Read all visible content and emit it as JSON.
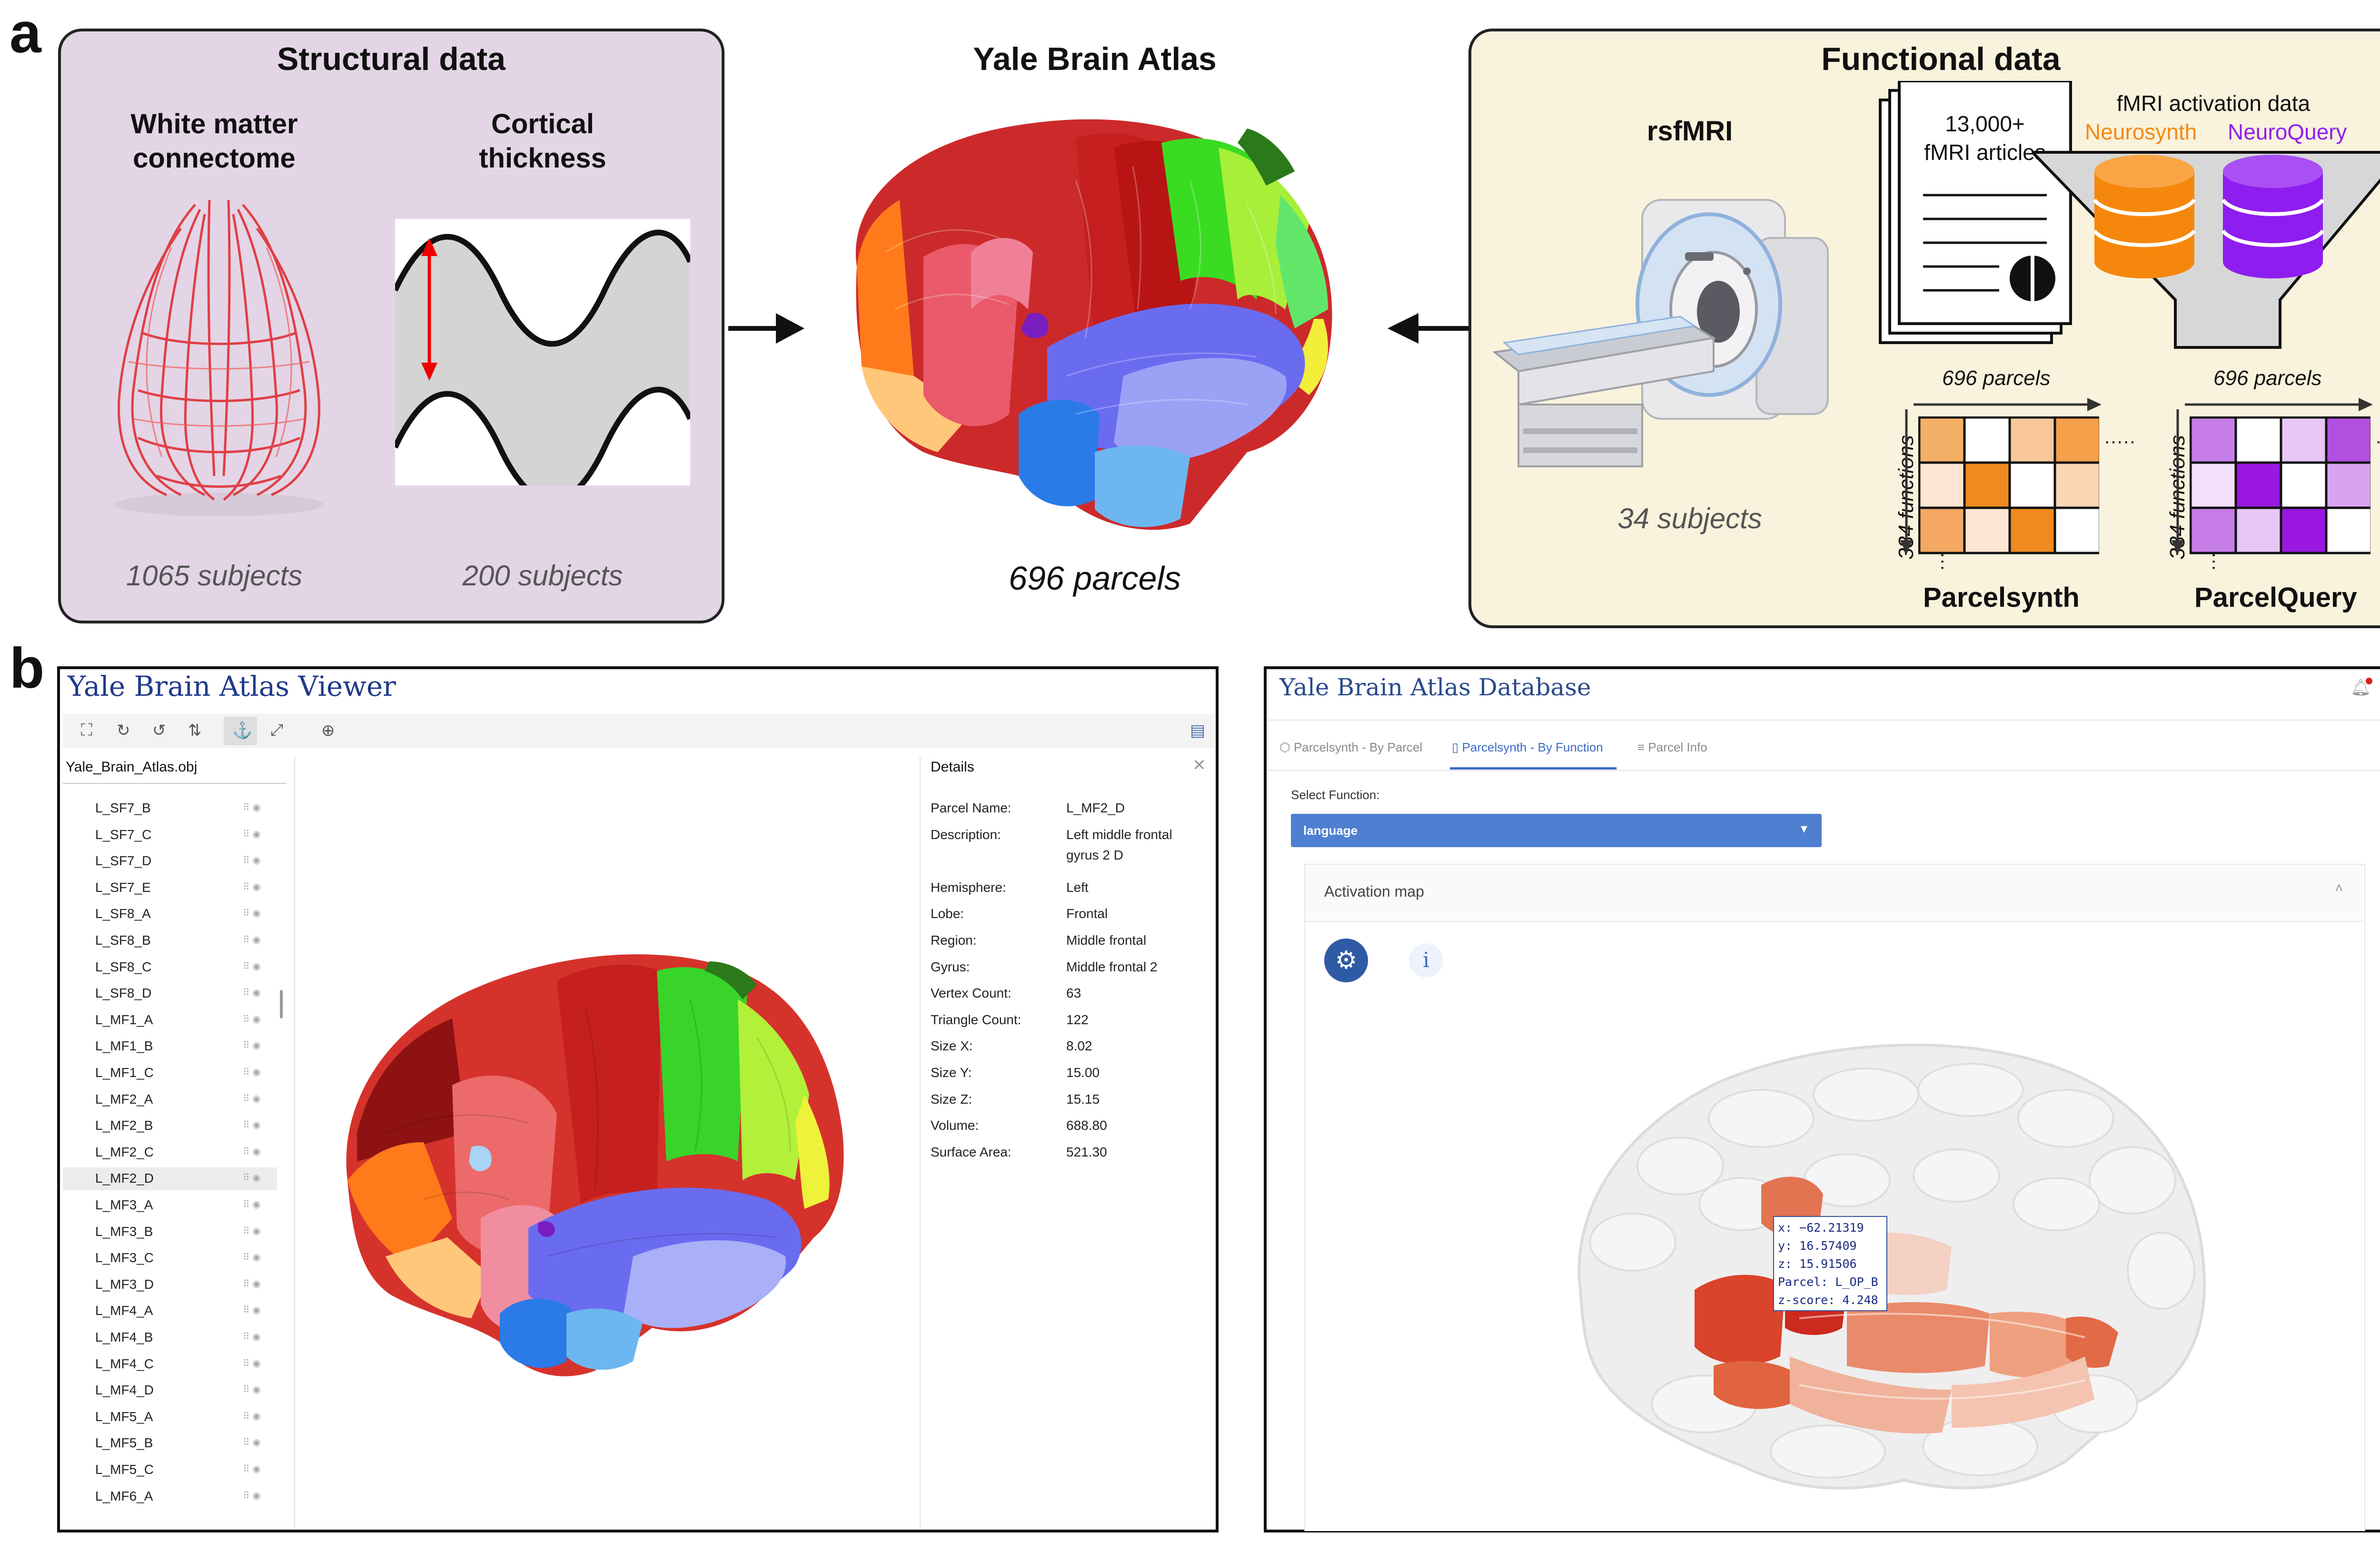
{
  "panel_a": {
    "letter": "a",
    "structural": {
      "title": "Structural data",
      "col1_title_line1": "White matter",
      "col1_title_line2": "connectome",
      "col2_title_line1": "Cortical",
      "col2_title_line2": "thickness",
      "col1_subjects": "1065 subjects",
      "col2_subjects": "200 subjects"
    },
    "center": {
      "title": "Yale Brain Atlas",
      "parcels": "696 parcels"
    },
    "functional": {
      "title": "Functional data",
      "rsfmri": "rsfMRI",
      "rsfmri_subjects": "34 subjects",
      "articles_line1": "13,000+",
      "articles_line2": "fMRI articles",
      "activation_title": "fMRI activation data",
      "neurosynth": "Neurosynth",
      "neuroquery": "NeuroQuery",
      "matrix1_top": "696 parcels",
      "matrix1_side": "334 functions",
      "matrix1_name": "Parcelsynth",
      "matrix2_top": "696 parcels",
      "matrix2_side": "334 functions",
      "matrix2_name": "ParcelQuery",
      "matrix1_cells": [
        "#f4b067",
        "#ffffff",
        "#f8c89a",
        "#f4a04a",
        "#fde6d2",
        "#f08a1e",
        "#ffffff",
        "#fad7b4",
        "#f4a862",
        "#fde6d2",
        "#f08a1e",
        "#ffffff"
      ],
      "matrix2_cells": [
        "#c77de8",
        "#ffffff",
        "#e8c6f6",
        "#b24fe0",
        "#f2e0fa",
        "#9a18e0",
        "#ffffff",
        "#d9a3f0",
        "#c77de8",
        "#e8c6f6",
        "#9a18e0",
        "#ffffff"
      ]
    },
    "colors": {
      "structural_bg": "#e3d5e6",
      "functional_bg": "#f9f2dd",
      "neurosynth": "#f5880c",
      "neuroquery": "#8e1df0"
    }
  },
  "panel_b": {
    "letter": "b",
    "viewer": {
      "title": "Yale Brain Atlas Viewer",
      "file": "Yale_Brain_Atlas.obj",
      "list": [
        "L_SF7_B",
        "L_SF7_C",
        "L_SF7_D",
        "L_SF7_E",
        "L_SF8_A",
        "L_SF8_B",
        "L_SF8_C",
        "L_SF8_D",
        "L_MF1_A",
        "L_MF1_B",
        "L_MF1_C",
        "L_MF2_A",
        "L_MF2_B",
        "L_MF2_C",
        "L_MF2_D",
        "L_MF3_A",
        "L_MF3_B",
        "L_MF3_C",
        "L_MF3_D",
        "L_MF4_A",
        "L_MF4_B",
        "L_MF4_C",
        "L_MF4_D",
        "L_MF5_A",
        "L_MF5_B",
        "L_MF5_C",
        "L_MF6_A"
      ],
      "selected": "L_MF2_D",
      "details_title": "Details",
      "details": [
        {
          "k": "Parcel Name:",
          "v": "L_MF2_D"
        },
        {
          "k": "Description:",
          "v": "Left middle frontal"
        },
        {
          "k": "",
          "v": "gyrus 2 D"
        },
        {
          "k": "Hemisphere:",
          "v": "Left"
        },
        {
          "k": "Lobe:",
          "v": "Frontal"
        },
        {
          "k": "Region:",
          "v": "Middle frontal"
        },
        {
          "k": "Gyrus:",
          "v": "Middle frontal 2"
        },
        {
          "k": "Vertex Count:",
          "v": "63"
        },
        {
          "k": "Triangle Count:",
          "v": "122"
        },
        {
          "k": "Size X:",
          "v": "8.02"
        },
        {
          "k": "Size Y:",
          "v": "15.00"
        },
        {
          "k": "Size Z:",
          "v": "15.15"
        },
        {
          "k": "Volume:",
          "v": "688.80"
        },
        {
          "k": "Surface Area:",
          "v": "521.30"
        }
      ]
    },
    "database": {
      "title": "Yale Brain Atlas Database",
      "tabs": [
        "Parcelsynth - By Parcel",
        "Parcelsynth - By Function",
        "Parcel Info"
      ],
      "select_label": "Select Function:",
      "select_value": "language",
      "card_title": "Activation map",
      "tooltip": [
        "x: −62.21319",
        "y: 16.57409",
        "z: 15.91506",
        "Parcel: L_OP_B",
        "z-score: 4.248"
      ]
    }
  }
}
